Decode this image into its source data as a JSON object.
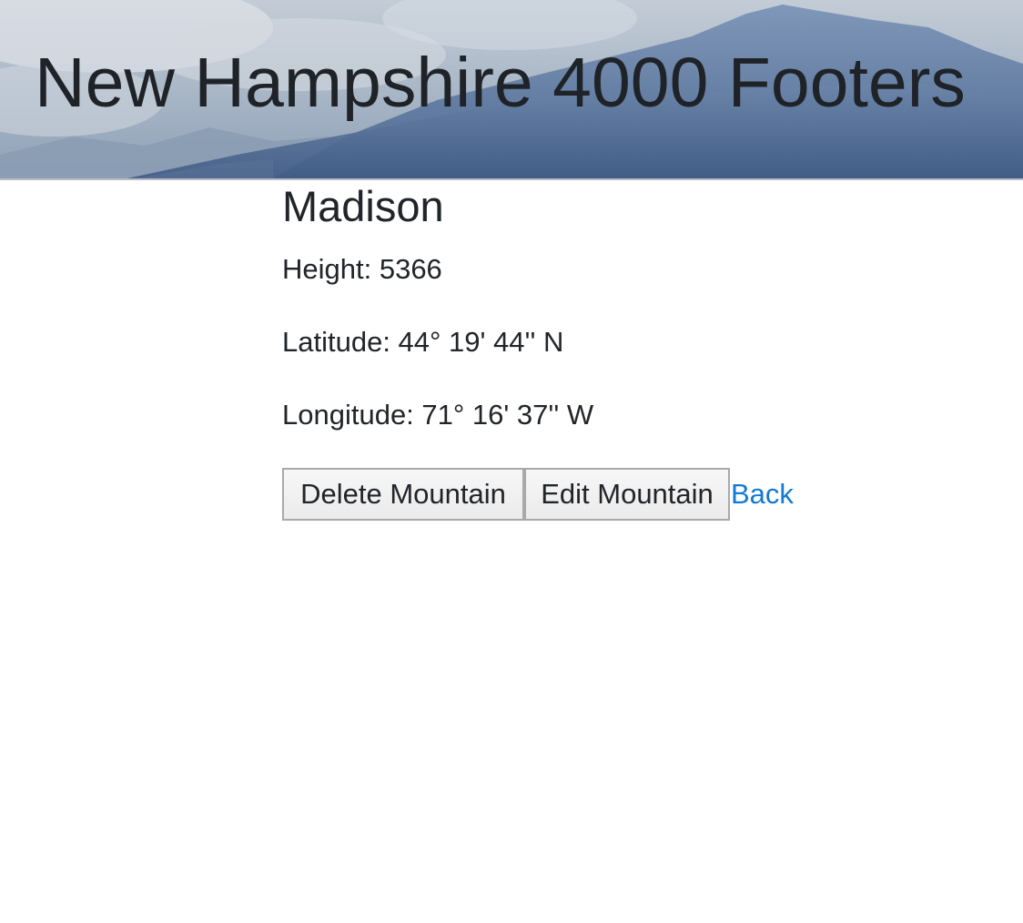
{
  "header": {
    "title": "New Hampshire 4000 Footers"
  },
  "mountain": {
    "name": "Madison",
    "height_text": "Height: 5366",
    "latitude_text": "Latitude: 44° 19' 44'' N",
    "longitude_text": "Longitude: 71° 16' 37'' W"
  },
  "actions": {
    "delete_label": "Delete Mountain",
    "edit_label": "Edit Mountain",
    "back_label": "Back"
  },
  "colors": {
    "link": "#1379d6",
    "text": "#212529",
    "button_border": "#a9a9a9"
  }
}
